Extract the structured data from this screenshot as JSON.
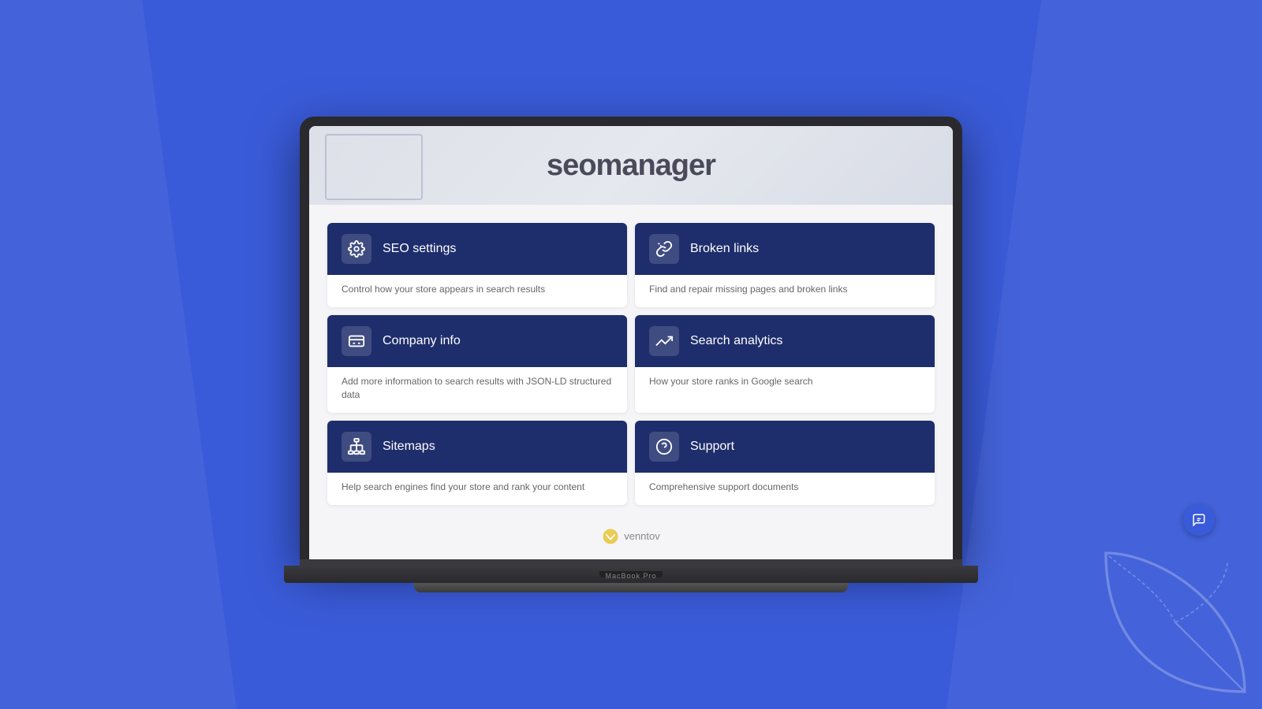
{
  "background": {
    "color": "#3a5bd9"
  },
  "app": {
    "logo_text": "seomanager",
    "logo_prefix": "seo",
    "logo_suffix": "manager"
  },
  "menu_cards": [
    {
      "id": "seo-settings",
      "title": "SEO settings",
      "description": "Control how your store appears in search results",
      "icon": "gear"
    },
    {
      "id": "broken-links",
      "title": "Broken links",
      "description": "Find and repair missing pages and broken links",
      "icon": "broken-link"
    },
    {
      "id": "company-info",
      "title": "Company info",
      "description": "Add more information to search results with JSON-LD structured data",
      "icon": "card"
    },
    {
      "id": "search-analytics",
      "title": "Search analytics",
      "description": "How your store ranks in Google search",
      "icon": "chart"
    },
    {
      "id": "sitemaps",
      "title": "Sitemaps",
      "description": "Help search engines find your store and rank your content",
      "icon": "sitemap"
    },
    {
      "id": "support",
      "title": "Support",
      "description": "Comprehensive support documents",
      "icon": "question"
    }
  ],
  "footer": {
    "brand": "venntov"
  },
  "laptop": {
    "model": "MacBook Pro"
  },
  "floating_button": {
    "label": "chat"
  }
}
